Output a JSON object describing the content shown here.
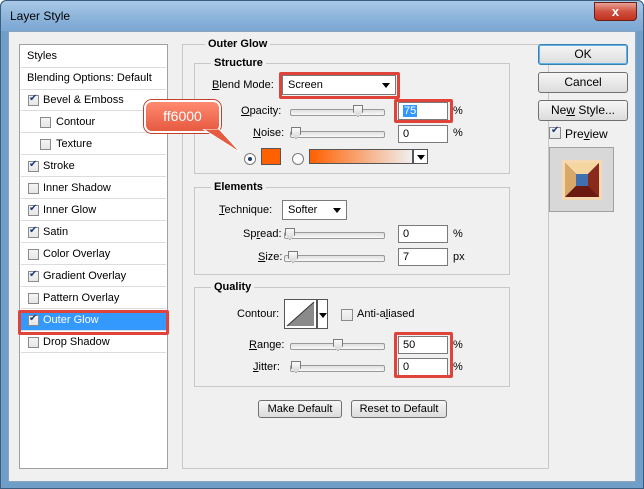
{
  "window": {
    "title": "Layer Style",
    "close_label": "x"
  },
  "sidebar": {
    "header": "Styles",
    "blending": "Blending Options: Default",
    "items": [
      {
        "label": "Bevel & Emboss",
        "checked": true
      },
      {
        "label": "Contour",
        "checked": false
      },
      {
        "label": "Texture",
        "checked": false
      },
      {
        "label": "Stroke",
        "checked": true
      },
      {
        "label": "Inner Shadow",
        "checked": false
      },
      {
        "label": "Inner Glow",
        "checked": true
      },
      {
        "label": "Satin",
        "checked": true
      },
      {
        "label": "Color Overlay",
        "checked": false
      },
      {
        "label": "Gradient Overlay",
        "checked": true
      },
      {
        "label": "Pattern Overlay",
        "checked": false
      },
      {
        "label": "Outer Glow",
        "checked": true,
        "selected": true
      },
      {
        "label": "Drop Shadow",
        "checked": false
      }
    ]
  },
  "outer_glow": {
    "title": "Outer Glow",
    "structure": {
      "title": "Structure",
      "blend_mode_label_pre": "B",
      "blend_mode_label_rest": "lend Mode:",
      "blend_mode_value": "Screen",
      "opacity_label_pre": "O",
      "opacity_label_rest": "pacity:",
      "opacity_value": "75",
      "opacity_level": 0.75,
      "opacity_unit": "%",
      "noise_label_pre": "N",
      "noise_label_rest": "oise:",
      "noise_value": "0",
      "noise_level": 0,
      "noise_unit": "%",
      "glow_color": "#ff6000"
    },
    "elements": {
      "title": "Elements",
      "technique_label_pre": "T",
      "technique_label_rest": "echnique:",
      "technique_value": "Softer",
      "spread_label_pre": "Sp",
      "spread_label_u": "r",
      "spread_label_rest": "ead:",
      "spread_value": "0",
      "spread_level": 0,
      "spread_unit": "%",
      "size_label_pre": "S",
      "size_label_rest": "ize:",
      "size_value": "7",
      "size_level": 0.03,
      "size_unit": "px"
    },
    "quality": {
      "title": "Quality",
      "contour_label": "Contour:",
      "anti_aliased_pre": "Anti-a",
      "anti_aliased_u": "l",
      "anti_aliased_rest": "iased",
      "range_label_pre": "R",
      "range_label_rest": "ange:",
      "range_value": "50",
      "range_level": 0.5,
      "range_unit": "%",
      "jitter_label_pre": "J",
      "jitter_label_rest": "itter:",
      "jitter_value": "0",
      "jitter_level": 0,
      "jitter_unit": "%"
    },
    "make_default": "Make Default",
    "reset_default": "Reset to Default"
  },
  "right": {
    "ok": "OK",
    "cancel": "Cancel",
    "new_style_pre": "Ne",
    "new_style_u": "w",
    "new_style_rest": " Style...",
    "preview_label_pre": "Pre",
    "preview_label_u": "v",
    "preview_label_rest": "iew",
    "preview_checked": true
  },
  "annotation": {
    "callout_text": "ff6000",
    "accent": "#e0433a"
  }
}
